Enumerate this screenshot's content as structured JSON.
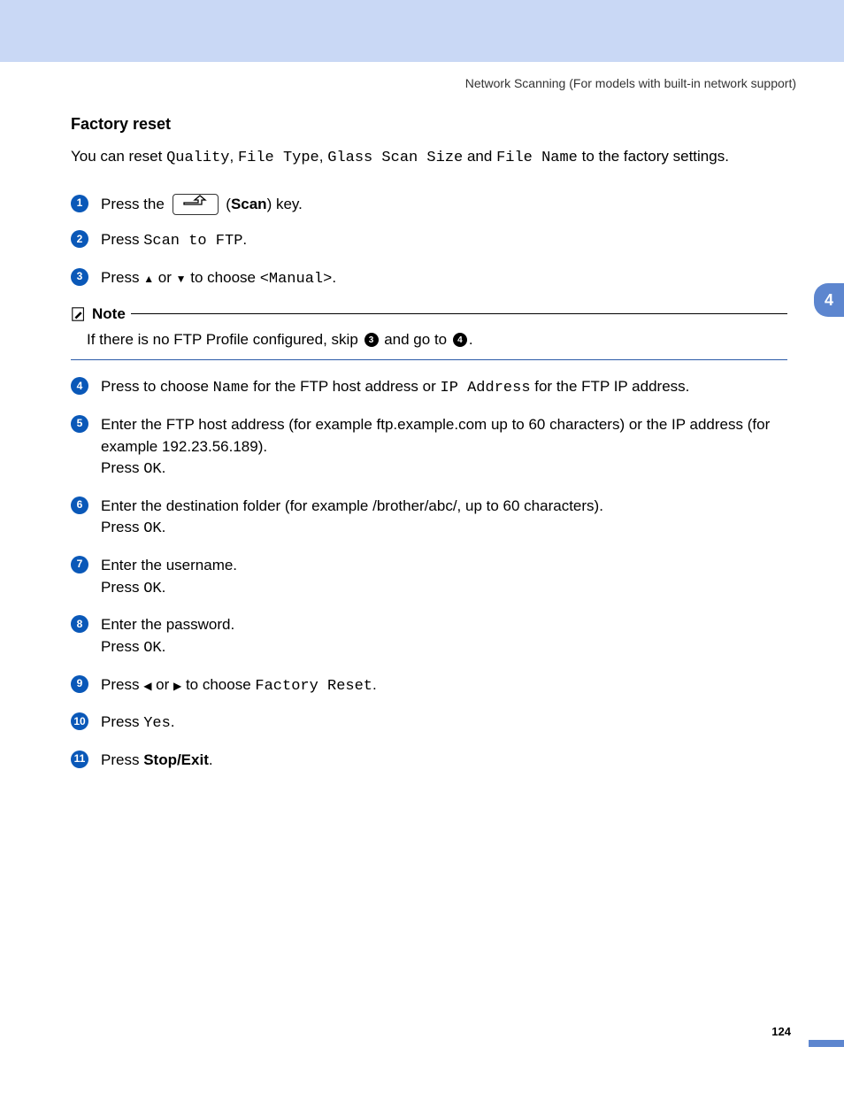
{
  "header": "Network Scanning  (For models with built-in network support)",
  "chapter": "4",
  "page": "124",
  "title": "Factory reset",
  "intro": {
    "lead": "You can reset ",
    "q": "Quality",
    "ft": "File Type",
    "gs": "Glass Scan Size",
    "fn": "File Name",
    "tail": " to the factory settings.",
    "comma": ", ",
    "and": " and "
  },
  "steps": {
    "s1": {
      "n": "1",
      "a": "Press the ",
      "b": "Scan",
      "c": ") key."
    },
    "s2": {
      "n": "2",
      "a": "Press ",
      "m": "Scan to FTP",
      "c": "."
    },
    "s3": {
      "n": "3",
      "a": "Press ",
      "up": "▲",
      "or": " or ",
      "dn": "▼",
      "b": " to choose ",
      "m": "<Manual>",
      "c": "."
    },
    "s4": {
      "n": "4",
      "a": "Press to choose ",
      "m1": "Name",
      "b": " for the FTP host address or ",
      "m2": "IP Address",
      "c": " for the FTP IP address."
    },
    "s5": {
      "n": "5",
      "a": "Enter the FTP host address (for example ftp.example.com up to 60 characters) or the IP address (for example 192.23.56.189).",
      "p": "Press ",
      "ok": "OK",
      "d": "."
    },
    "s6": {
      "n": "6",
      "a": "Enter the destination folder (for example /brother/abc/, up to 60 characters).",
      "p": "Press ",
      "ok": "OK",
      "d": "."
    },
    "s7": {
      "n": "7",
      "a": "Enter the username.",
      "p": "Press ",
      "ok": "OK",
      "d": "."
    },
    "s8": {
      "n": "8",
      "a": "Enter the password.",
      "p": "Press ",
      "ok": "OK",
      "d": "."
    },
    "s9": {
      "n": "9",
      "a": "Press ",
      "l": "◀",
      "or": " or ",
      "r": "▶",
      "b": " to choose ",
      "m": "Factory Reset",
      "c": "."
    },
    "s10": {
      "n": "10",
      "a": "Press ",
      "m": "Yes",
      "c": "."
    },
    "s11": {
      "n": "11",
      "a": "Press ",
      "b": "Stop/Exit",
      "c": "."
    }
  },
  "note": {
    "label": "Note",
    "a": "If there is no FTP Profile configured, skip ",
    "ref1": "3",
    "b": " and go to ",
    "ref2": "4",
    "c": "."
  }
}
